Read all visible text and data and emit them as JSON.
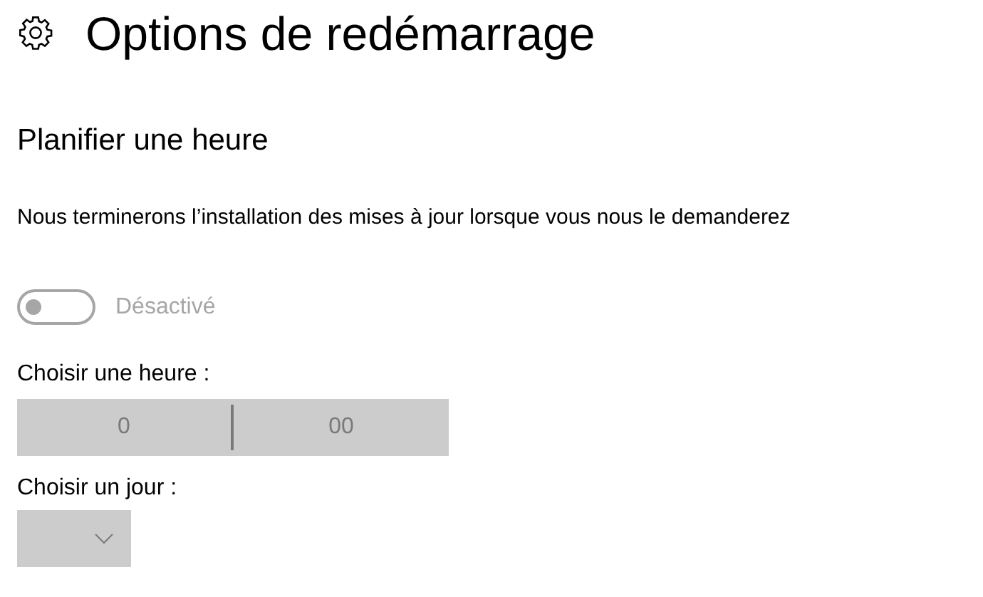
{
  "page": {
    "title": "Options de redémarrage"
  },
  "section": {
    "heading": "Planifier une heure",
    "description": "Nous terminerons l’installation des mises à jour lorsque vous nous le demanderez"
  },
  "toggle": {
    "on": false,
    "disabled": true,
    "label": "Désactivé"
  },
  "time_picker": {
    "label": "Choisir une heure :",
    "hour": "0",
    "minute": "00",
    "disabled": true
  },
  "day_picker": {
    "label": "Choisir un jour :",
    "disabled": true
  }
}
